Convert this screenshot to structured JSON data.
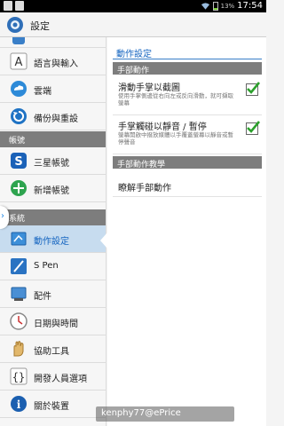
{
  "status_bar": {
    "battery": "13%",
    "time": "17:54"
  },
  "action_bar": {
    "title": "設定",
    "icon": "settings-gear-icon"
  },
  "sidebar": {
    "top_items": [
      {
        "label": "語言與輸入",
        "icon": "keyboard-icon"
      },
      {
        "label": "雲端",
        "icon": "cloud-icon"
      },
      {
        "label": "備份與重設",
        "icon": "backup-restore-icon"
      }
    ],
    "accounts_header": "帳號",
    "account_items": [
      {
        "label": "三星帳號",
        "icon": "samsung-account-icon"
      },
      {
        "label": "新增帳號",
        "icon": "add-account-icon"
      }
    ],
    "system_header": "系統",
    "system_items": [
      {
        "label": "動作設定",
        "icon": "motion-icon",
        "selected": true
      },
      {
        "label": "S Pen",
        "icon": "s-pen-icon"
      },
      {
        "label": "配件",
        "icon": "accessory-icon"
      },
      {
        "label": "日期與時間",
        "icon": "clock-icon"
      },
      {
        "label": "協助工具",
        "icon": "accessibility-hand-icon"
      },
      {
        "label": "開發人員選項",
        "icon": "developer-braces-icon"
      },
      {
        "label": "關於裝置",
        "icon": "info-icon"
      }
    ]
  },
  "detail": {
    "title": "動作設定",
    "section1_header": "手部動作",
    "options": [
      {
        "title": "滑動手掌以截圖",
        "desc": "使用手掌側邊從右向左或反向滑動，就可擷取螢幕",
        "checked": true
      },
      {
        "title": "手掌觸碰以靜音 / 暫停",
        "desc": "螢幕開啟中撥放媒體以手覆蓋螢幕以靜音或暫停聲音",
        "checked": true
      }
    ],
    "section2_header": "手部動作教學",
    "tutorial_link": "瞭解手部動作"
  },
  "watermark": "kenphy77@ePrice",
  "colors": {
    "accent": "#1565c0",
    "selected_bg": "#c7dcef",
    "header_bg": "#7d7d7d"
  }
}
